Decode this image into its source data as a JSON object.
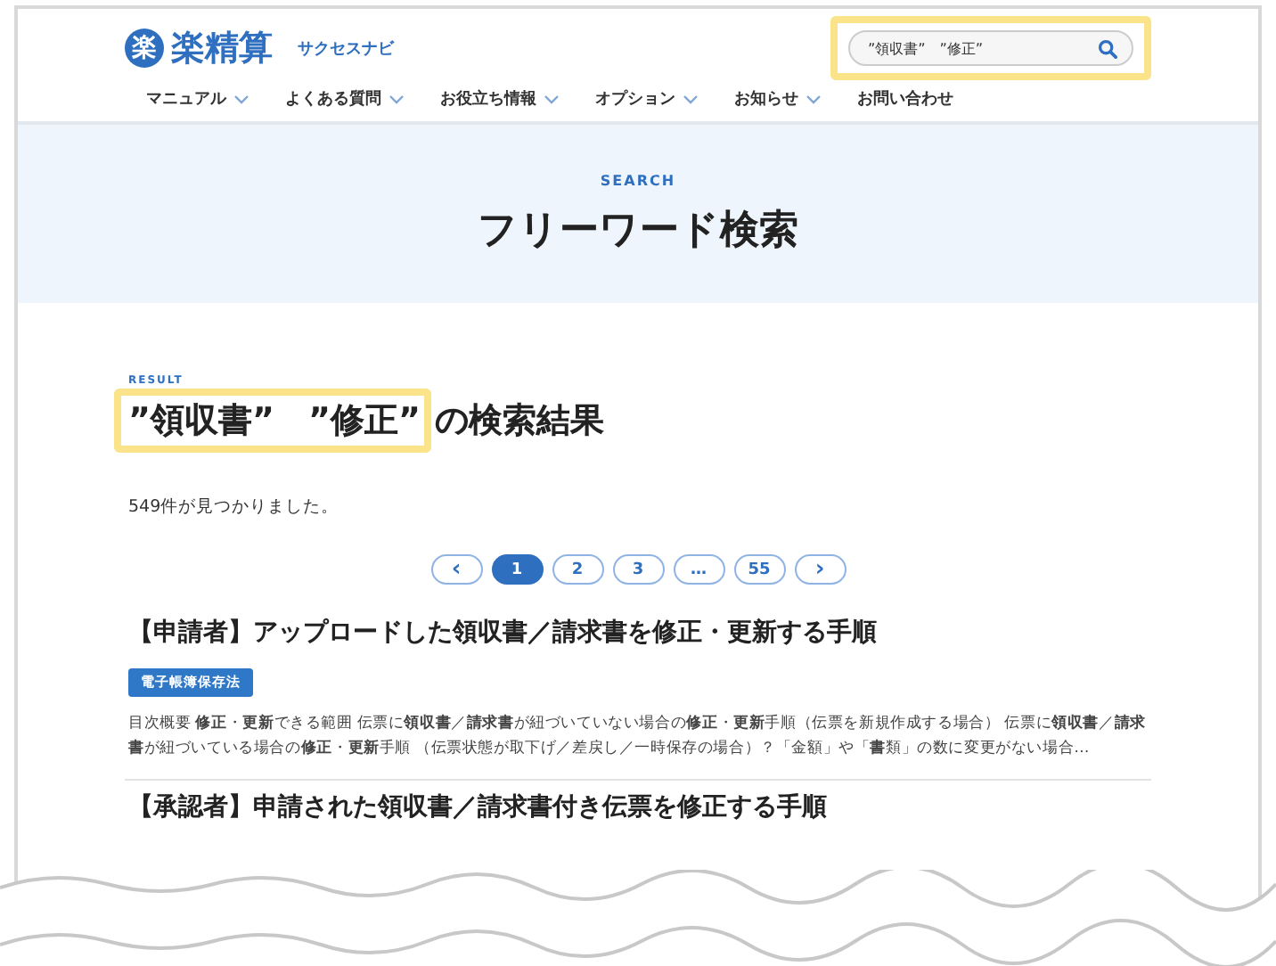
{
  "header": {
    "logo_mark": "楽",
    "logo_text": "楽精算",
    "logo_sub": "サクセスナビ",
    "search": {
      "value": "”領収書”　”修正”"
    }
  },
  "nav": [
    {
      "label": "マニュアル",
      "dropdown": true
    },
    {
      "label": "よくある質問",
      "dropdown": true
    },
    {
      "label": "お役立ち情報",
      "dropdown": true
    },
    {
      "label": "オプション",
      "dropdown": true
    },
    {
      "label": "お知らせ",
      "dropdown": true
    },
    {
      "label": "お問い合わせ",
      "dropdown": false
    }
  ],
  "hero": {
    "eyebrow": "SEARCH",
    "title": "フリーワード検索"
  },
  "results": {
    "eyebrow": "RESULT",
    "query": "”領収書”　”修正”",
    "heading_suffix": "の検索結果",
    "count": "549件が見つかりました。",
    "pagination": [
      {
        "label": "‹",
        "kind": "arrow",
        "selected": false
      },
      {
        "label": "1",
        "kind": "page",
        "selected": true
      },
      {
        "label": "2",
        "kind": "page",
        "selected": false
      },
      {
        "label": "3",
        "kind": "page",
        "selected": false
      },
      {
        "label": "…",
        "kind": "page",
        "selected": false
      },
      {
        "label": "55",
        "kind": "page",
        "selected": false
      },
      {
        "label": "›",
        "kind": "arrow",
        "selected": false
      }
    ],
    "items": [
      {
        "title": "【申請者】アップロードした領収書／請求書を修正・更新する手順",
        "tag": "電子帳簿保存法",
        "excerpt": "目次概要 **修正**・**更新**できる範囲 伝票に**領収書**／**請求書**が紐づいていない場合の**修正**・**更新**手順（伝票を新規作成する場合） 伝票に**領収書**／**請求書**が紐づいている場合の**修正**・**更新**手順 （伝票状態が取下げ／差戻し／一時保存の場合）？「金額」や「**書**類」の数に変更がない場合…"
      },
      {
        "title": "【承認者】申請された領収書／請求書付き伝票を修正する手順"
      }
    ]
  }
}
